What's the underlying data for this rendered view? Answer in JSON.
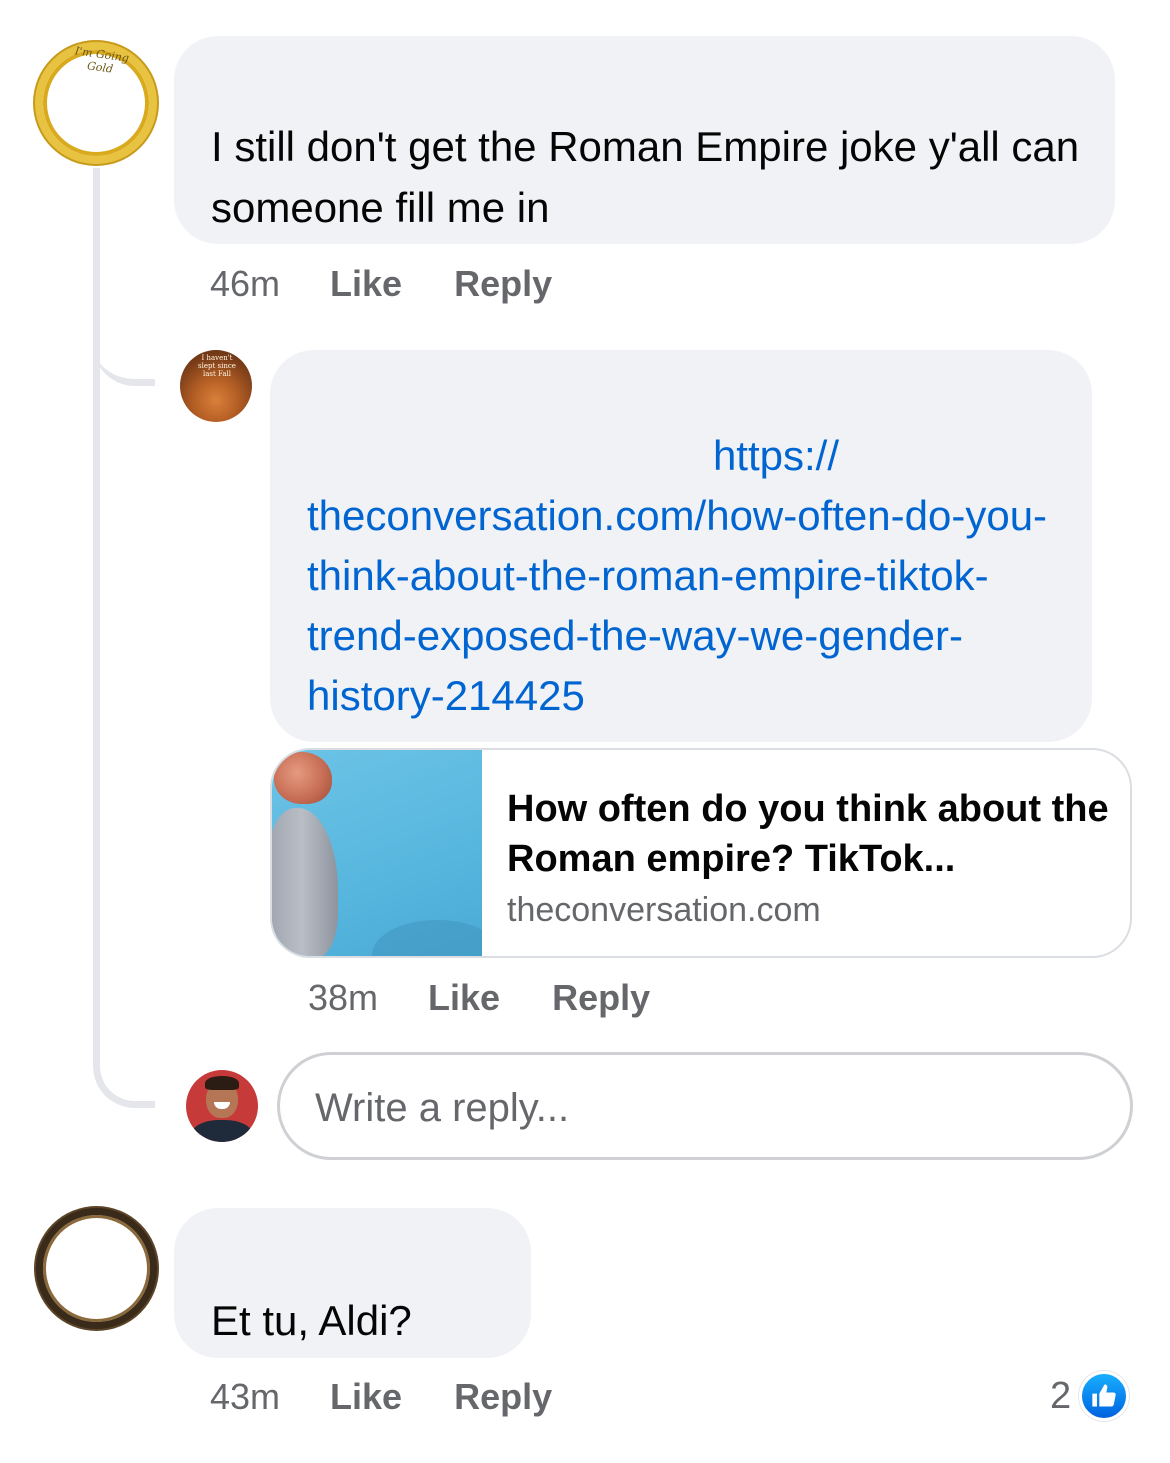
{
  "comments": [
    {
      "avatar_ring_text": "I'm Going Gold",
      "text": "I still don't get the Roman Empire joke y'all can someone fill me in",
      "time": "46m",
      "like_label": "Like",
      "reply_label": "Reply"
    },
    {
      "avatar_ring_text": "I haven't slept since last Fall",
      "link_line1": "https://",
      "link_rest": "theconversation.com/how-often-do-you-think-about-the-roman-empire-tiktok-trend-exposed-the-way-we-gender-history-214425",
      "preview": {
        "title": "How often do you think about the Roman empire? TikTok...",
        "domain": "theconversation.com"
      },
      "time": "38m",
      "like_label": "Like",
      "reply_label": "Reply"
    },
    {
      "text": "Et tu, Aldi?",
      "time": "43m",
      "like_label": "Like",
      "reply_label": "Reply",
      "reaction_count": "2",
      "reaction_icon": "thumbs-up-icon"
    }
  ],
  "reply_input": {
    "placeholder": "Write a reply..."
  },
  "colors": {
    "bubble": "#f0f2f5",
    "link": "#0064d1",
    "meta": "#65676b",
    "like_blue": "#0866ff"
  }
}
